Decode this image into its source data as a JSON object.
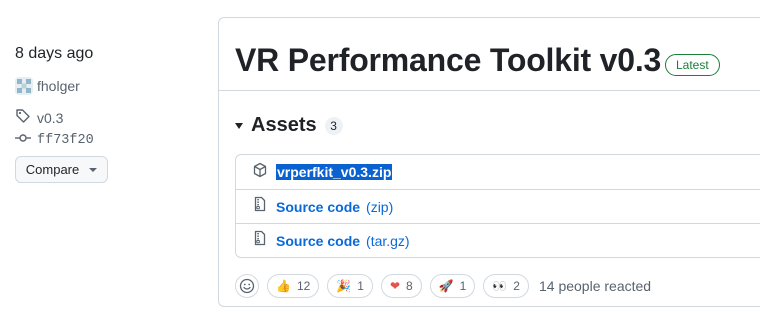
{
  "sidebar": {
    "date": "8 days ago",
    "author": "fholger",
    "tag": "v0.3",
    "commit": "ff73f20",
    "compare_label": "Compare"
  },
  "release": {
    "title": "VR Performance Toolkit v0.3",
    "latest_label": "Latest"
  },
  "assets": {
    "label": "Assets",
    "count": "3",
    "items": [
      {
        "name": "vrperfkit_v0.3.zip",
        "icon": "package-icon",
        "selected": true
      },
      {
        "name": "Source code",
        "suffix": "(zip)",
        "icon": "file-zip-icon"
      },
      {
        "name": "Source code",
        "suffix": "(tar.gz)",
        "icon": "file-zip-icon"
      }
    ]
  },
  "reactions": {
    "items": [
      {
        "emoji": "👍",
        "count": "12",
        "icon": "thumbs-up-icon"
      },
      {
        "emoji": "🎉",
        "count": "1",
        "icon": "tada-icon"
      },
      {
        "emoji": "❤",
        "count": "8",
        "icon": "heart-icon"
      },
      {
        "emoji": "🚀",
        "count": "1",
        "icon": "rocket-icon"
      },
      {
        "emoji": "👀",
        "count": "2",
        "icon": "eyes-icon"
      }
    ],
    "summary": "14 people reacted"
  },
  "colors": {
    "link": "#0969da",
    "latest": "#1a7f37",
    "border": "#d1d9e0",
    "selection": "#0a62d0"
  }
}
